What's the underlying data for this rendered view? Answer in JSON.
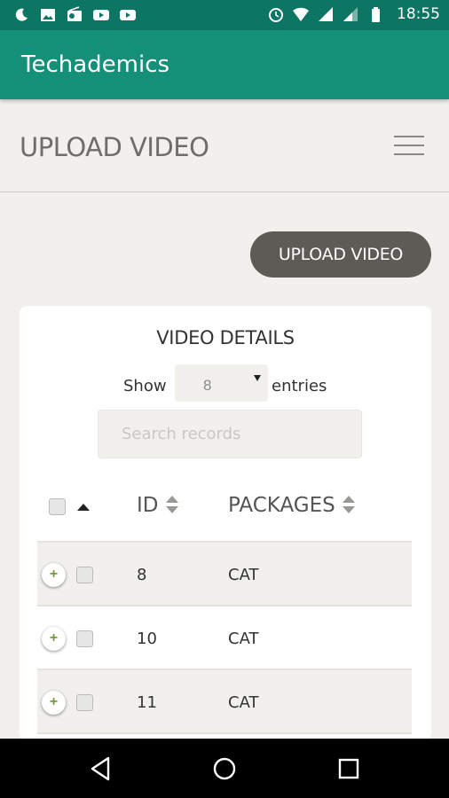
{
  "status_bar": {
    "time": "18:55",
    "icons": [
      "moon-icon",
      "image-icon",
      "radio-icon",
      "youtube-icon",
      "youtube-icon",
      "alarm-icon",
      "wifi-icon",
      "signal-icon",
      "signal-icon",
      "battery-icon"
    ]
  },
  "app_bar": {
    "title": "Techademics"
  },
  "page": {
    "title": "UPLOAD VIDEO"
  },
  "upload_button": {
    "label": "UPLOAD VIDEO"
  },
  "card": {
    "title": "VIDEO DETAILS",
    "show_label": "Show",
    "entries_label": "entries",
    "page_size": "8",
    "search_placeholder": "Search records"
  },
  "table": {
    "columns": [
      "ID",
      "PACKAGES"
    ],
    "rows": [
      {
        "id": "8",
        "package": "CAT"
      },
      {
        "id": "10",
        "package": "CAT"
      },
      {
        "id": "11",
        "package": "CAT"
      }
    ]
  },
  "colors": {
    "primary": "#148f78",
    "primary_dark": "#0d7563",
    "button": "#5e5a55",
    "background": "#f1f0ed"
  }
}
